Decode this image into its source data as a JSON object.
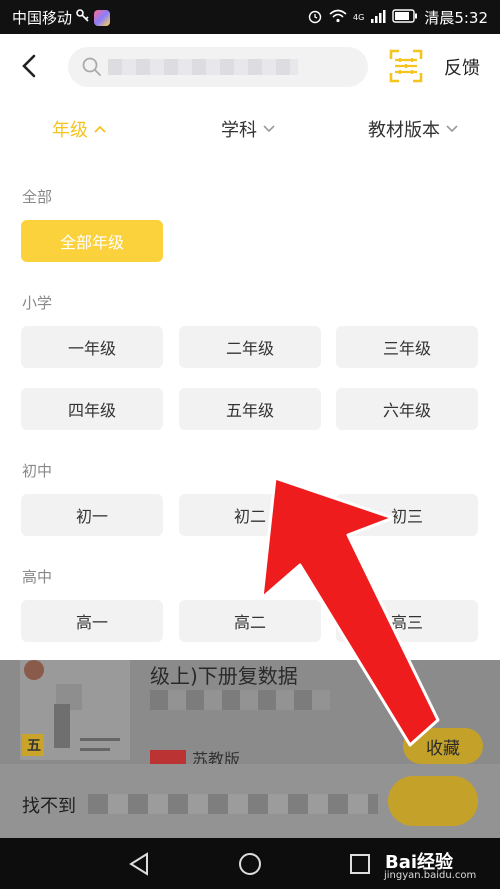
{
  "status_bar": {
    "carrier": "中国移动",
    "network": "4G",
    "time": "清晨5:32"
  },
  "header": {
    "back_icon": "back-arrow-icon",
    "search_icon": "search-icon",
    "scan_icon": "scan-icon",
    "feedback_label": "反馈"
  },
  "filters": [
    {
      "label": "年级",
      "active": true
    },
    {
      "label": "学科",
      "active": false
    },
    {
      "label": "教材版本",
      "active": false
    }
  ],
  "grade_panel": {
    "sections": [
      {
        "label": "全部",
        "items": [
          "全部年级"
        ]
      },
      {
        "label": "小学",
        "items": [
          "一年级",
          "二年级",
          "三年级",
          "四年级",
          "五年级",
          "六年级"
        ]
      },
      {
        "label": "初中",
        "items": [
          "初一",
          "初二",
          "初三"
        ]
      },
      {
        "label": "高中",
        "items": [
          "高一",
          "高二",
          "高三"
        ]
      }
    ],
    "selected": "全部年级"
  },
  "background_content": {
    "book_title": "级上)下册复数据",
    "cover_badge": "五",
    "tag": "苏教版",
    "collect_button": "收藏",
    "not_found_text": "找不到"
  },
  "nav_bar": {
    "back_icon": "nav-back-icon",
    "home_icon": "nav-home-icon",
    "recents_icon": "nav-recents-icon"
  },
  "watermark": {
    "text": "Bai经验",
    "subtext": "jingyan.baidu.com"
  },
  "colors": {
    "accent": "#fbd23c",
    "active_tab": "#f5c41f",
    "chip_bg": "#f2f2f3",
    "arrow": "#ee1c1c",
    "overlay": "#8b8b8b"
  }
}
